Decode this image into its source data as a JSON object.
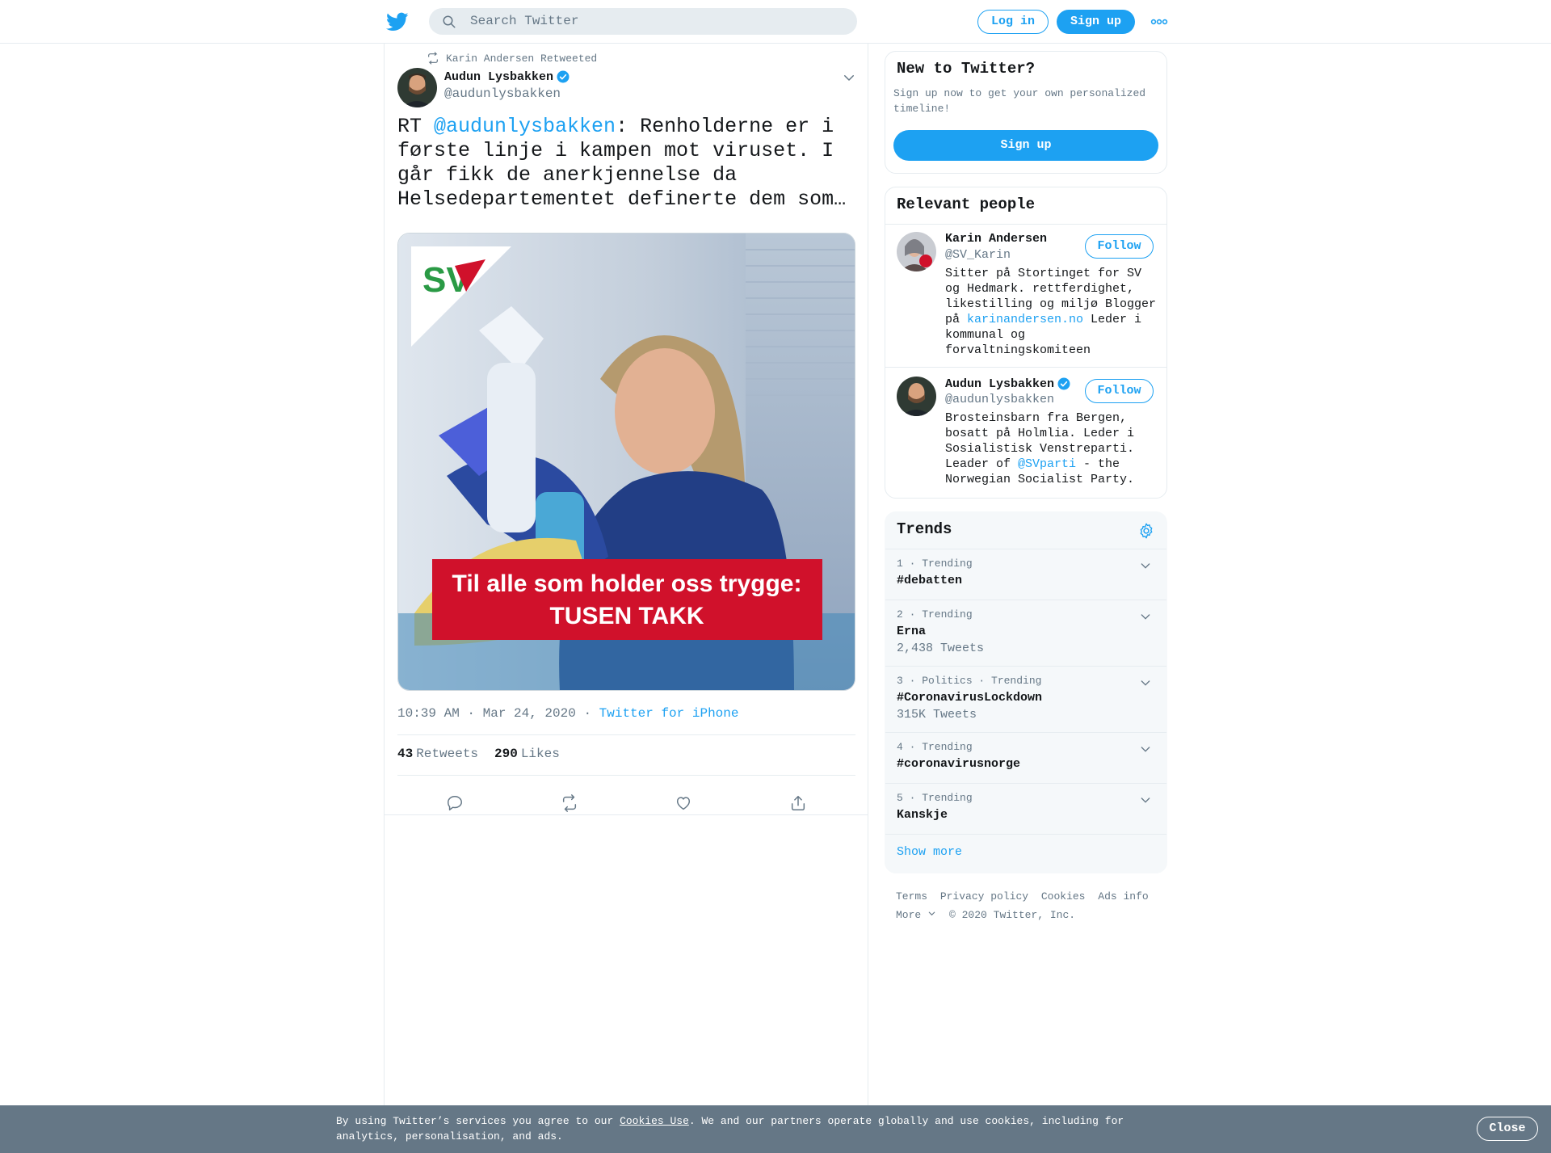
{
  "header": {
    "search_placeholder": "Search Twitter",
    "login_label": "Log in",
    "signup_label": "Sign up"
  },
  "tweet": {
    "retweeted_by": "Karin Andersen Retweeted",
    "author_name": "Audun Lysbakken",
    "author_handle": "@audunlysbakken",
    "text_prefix": "RT ",
    "text_mention": "@audunlysbakken",
    "text_body": ": Renholderne er i første linje i kampen mot viruset. I går fikk de anerkjennelse da Helsedepartementet definerte dem som…",
    "image_logo_text": "SV",
    "image_banner_line1": "Til alle som holder oss trygge:",
    "image_banner_line2": "TUSEN TAKK",
    "time": "10:39 AM · Mar 24, 2020 · ",
    "source": "Twitter for iPhone",
    "retweets_count": "43",
    "retweets_label": "Retweets",
    "likes_count": "290",
    "likes_label": "Likes"
  },
  "new_to_twitter": {
    "title": "New to Twitter?",
    "subtitle": "Sign up now to get your own personalized timeline!",
    "button": "Sign up"
  },
  "relevant_people": {
    "title": "Relevant people",
    "people": [
      {
        "name": "Karin Andersen",
        "handle": "@SV_Karin",
        "follow": "Follow",
        "bio_part1": "Sitter på Stortinget for SV og Hedmark. rettferdighet, likestilling og miljø Blogger på ",
        "bio_link": "karinandersen.no",
        "bio_part2": " Leder i kommunal og forvaltningskomiteen"
      },
      {
        "name": "Audun Lysbakken",
        "handle": "@audunlysbakken",
        "follow": "Follow",
        "bio_part1": "Brosteinsbarn fra Bergen, bosatt på Holmlia. Leder i Sosialistisk Venstreparti. Leader of ",
        "bio_link": "@SVparti",
        "bio_part2": " - the Norwegian Socialist Party."
      }
    ]
  },
  "trends": {
    "title": "Trends",
    "items": [
      {
        "context": "1 · Trending",
        "name": "#debatten",
        "count": ""
      },
      {
        "context": "2 · Trending",
        "name": "Erna",
        "count": "2,438 Tweets"
      },
      {
        "context": "3 · Politics · Trending",
        "name": "#CoronavirusLockdown",
        "count": "315K Tweets"
      },
      {
        "context": "4 · Trending",
        "name": "#coronavirusnorge",
        "count": ""
      },
      {
        "context": "5 · Trending",
        "name": "Kanskje",
        "count": ""
      }
    ],
    "show_more": "Show more"
  },
  "footer": {
    "terms": "Terms",
    "privacy": "Privacy policy",
    "cookies": "Cookies",
    "ads": "Ads info",
    "more": "More",
    "copyright": "© 2020 Twitter, Inc."
  },
  "cookie_bar": {
    "text_before": "By using Twitter’s services you agree to our ",
    "link": "Cookies Use",
    "text_after": ". We and our partners operate globally and use cookies, including for analytics, personalisation, and ads.",
    "close": "Close"
  },
  "colors": {
    "accent": "#1da1f2",
    "text": "#14171a",
    "muted": "#657786",
    "border": "#e6ecf0",
    "cookie_bg": "#657786",
    "sv_red": "#d0112b",
    "sv_green": "#2a9a45"
  },
  "icons": [
    "twitter-bird-icon",
    "search-icon",
    "more-dots-icon",
    "retweet-icon",
    "verified-icon",
    "chevron-down-icon",
    "reply-icon",
    "like-icon",
    "share-icon",
    "gear-icon"
  ]
}
